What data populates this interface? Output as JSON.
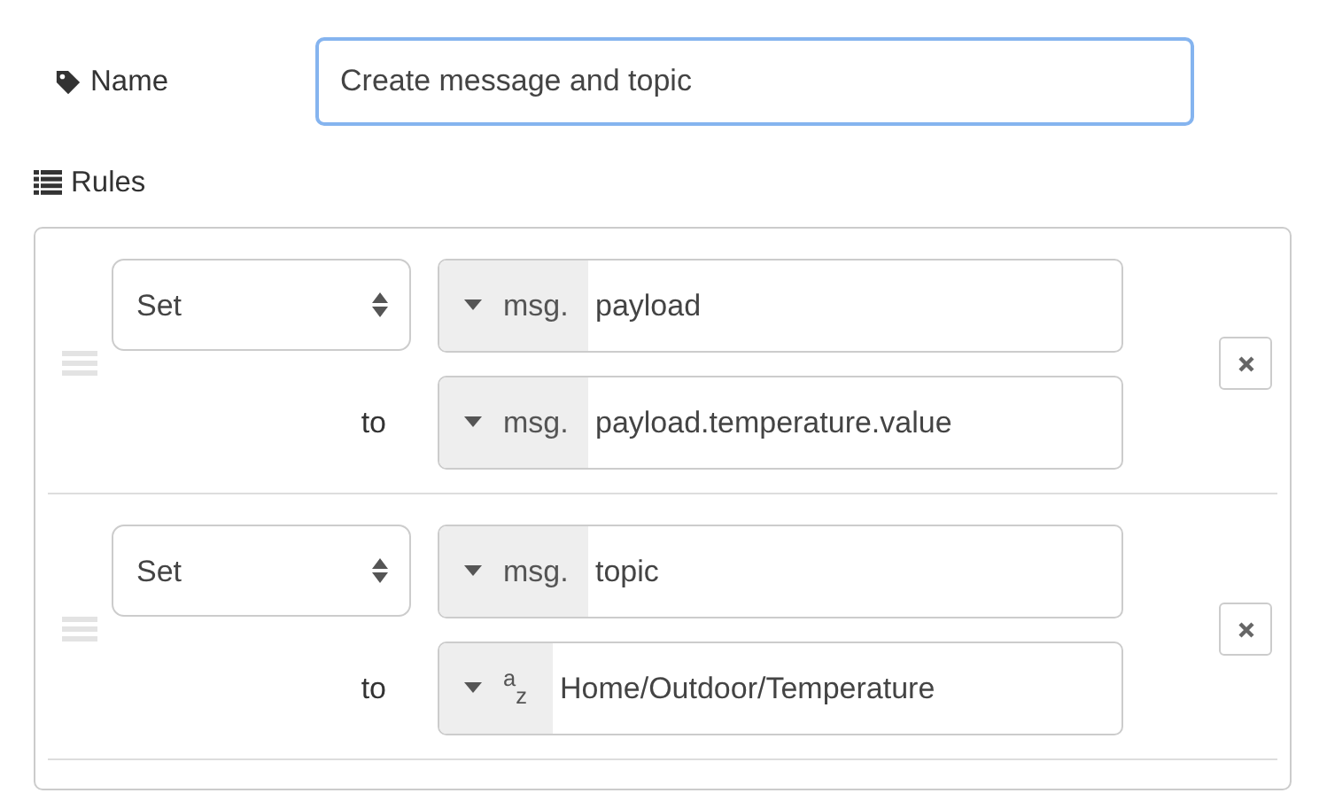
{
  "name_field": {
    "label": "Name",
    "value": "Create message and topic",
    "focused": true
  },
  "rules_label": "Rules",
  "rules": [
    {
      "action": "Set",
      "target": {
        "kind": "msg",
        "type_label": "msg.",
        "value": "payload"
      },
      "to_label": "to",
      "source": {
        "kind": "msg",
        "type_label": "msg.",
        "value": "payload.temperature.value"
      }
    },
    {
      "action": "Set",
      "target": {
        "kind": "msg",
        "type_label": "msg.",
        "value": "topic"
      },
      "to_label": "to",
      "source": {
        "kind": "str",
        "type_label": "$^{a}$$_{z}$",
        "value": "Home/Outdoor/Temperature"
      }
    }
  ]
}
